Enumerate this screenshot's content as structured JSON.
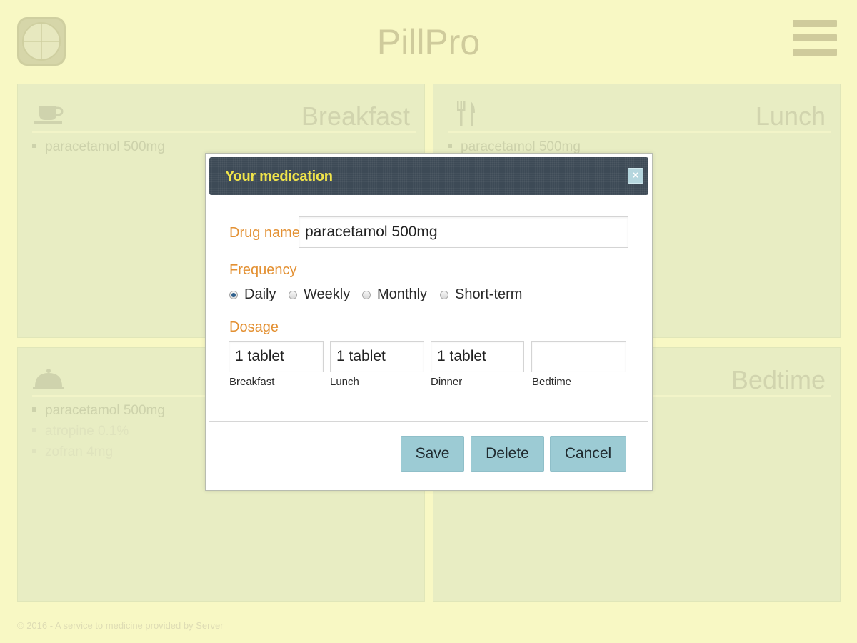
{
  "app": {
    "title": "PillPro",
    "footer": "© 2016 - A service to medicine provided by Server"
  },
  "panels": {
    "breakfast": {
      "title": "Breakfast",
      "icon": "coffee-cup-icon",
      "items": [
        "paracetamol 500mg"
      ]
    },
    "lunch": {
      "title": "Lunch",
      "icon": "fork-knife-icon",
      "items": [
        "paracetamol 500mg"
      ]
    },
    "dinner": {
      "title": "",
      "icon": "cloche-icon",
      "items": [
        "paracetamol 500mg",
        "atropine 0.1%",
        "zofran 4mg"
      ]
    },
    "bedtime": {
      "title": "Bedtime",
      "icon": "",
      "items": []
    }
  },
  "modal": {
    "title": "Your medication",
    "close_label": "×",
    "drug_name_label": "Drug name",
    "drug_name_value": "paracetamol 500mg",
    "frequency_label": "Frequency",
    "frequency_options": [
      "Daily",
      "Weekly",
      "Monthly",
      "Short-term"
    ],
    "frequency_selected": "Daily",
    "dosage_label": "Dosage",
    "dosage": [
      {
        "caption": "Breakfast",
        "value": "1 tablet"
      },
      {
        "caption": "Lunch",
        "value": "1 tablet"
      },
      {
        "caption": "Dinner",
        "value": "1 tablet"
      },
      {
        "caption": "Bedtime",
        "value": ""
      }
    ],
    "buttons": {
      "save": "Save",
      "delete": "Delete",
      "cancel": "Cancel"
    }
  },
  "colors": {
    "page_background": "#f8f8c4",
    "panel_background": "#e8edc3",
    "modal_header": "#3d4a56",
    "modal_title": "#f0e44a",
    "label_orange": "#e39032",
    "button": "#9ccbd4"
  }
}
